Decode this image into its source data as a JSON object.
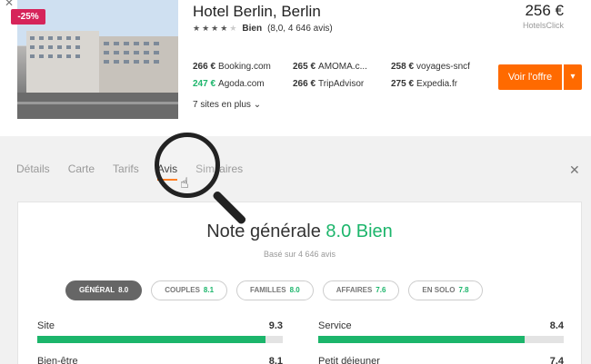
{
  "hotel": {
    "name": "Hotel Berlin, Berlin",
    "discount_badge": "-25%",
    "stars_filled": 4,
    "stars_total": 5,
    "rating_word": "Bien",
    "rating_detail": "(8,0, 4 646 avis)",
    "price": "256 €",
    "price_source": "HotelsClick"
  },
  "prices": [
    {
      "value": "266 €",
      "site": "Booking.com",
      "highlight": false
    },
    {
      "value": "265 €",
      "site": "AMOMA.c...",
      "highlight": false
    },
    {
      "value": "258 €",
      "site": "voyages-sncf",
      "highlight": false
    },
    {
      "value": "247 €",
      "site": "Agoda.com",
      "highlight": true
    },
    {
      "value": "266 €",
      "site": "TripAdvisor",
      "highlight": false
    },
    {
      "value": "275 €",
      "site": "Expedia.fr",
      "highlight": false
    }
  ],
  "more_sites": "7 sites en plus",
  "offer_button": "Voir l'offre",
  "tabs": [
    "Détails",
    "Carte",
    "Tarifs",
    "Avis",
    "Similaires"
  ],
  "active_tab": "Avis",
  "review": {
    "title": "Note générale",
    "score": "8.0 Bien",
    "subtitle": "Basé sur 4 646 avis"
  },
  "filters": [
    {
      "label": "GÉNÉRAL",
      "value": "8.0",
      "active": true
    },
    {
      "label": "COUPLES",
      "value": "8.1",
      "active": false
    },
    {
      "label": "FAMILLES",
      "value": "8.0",
      "active": false
    },
    {
      "label": "AFFAIRES",
      "value": "7.6",
      "active": false
    },
    {
      "label": "EN SOLO",
      "value": "7.8",
      "active": false
    }
  ],
  "metrics": [
    {
      "label": "Site",
      "value": "9.3"
    },
    {
      "label": "Service",
      "value": "8.4"
    },
    {
      "label": "Bien-être",
      "value": "8.1"
    },
    {
      "label": "Petit déjeuner",
      "value": "7.4"
    }
  ],
  "colors": {
    "accent_orange": "#ff6a00",
    "rating_green": "#1cb56b",
    "discount_pink": "#d6245a"
  }
}
